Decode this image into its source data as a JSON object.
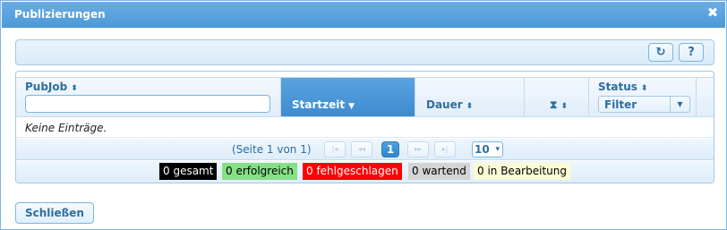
{
  "dialog": {
    "title": "Publizierungen",
    "close_symbol": "✖"
  },
  "toolbar": {
    "refresh_icon": "↻",
    "help_label": "?"
  },
  "grid": {
    "columns": [
      {
        "label": "PubJob",
        "sort_icon": "⬍"
      },
      {
        "label": "Startzeit",
        "sort_icon": "▼"
      },
      {
        "label": "Dauer",
        "sort_icon": "⬍"
      },
      {
        "label": "⧗",
        "sort_icon": "⬍"
      },
      {
        "label": "Status",
        "sort_icon": "⬍"
      }
    ],
    "pubjob_filter_value": "",
    "status_filter": {
      "selected": "Filter",
      "arrow": "▼"
    },
    "empty_text": "Keine Einträge."
  },
  "pager": {
    "info": "(Seite 1 von 1)",
    "first": "|◂",
    "prev": "◂◂",
    "current_page": "1",
    "next": "▸▸",
    "last": "▸|",
    "page_size": "10",
    "page_size_arrow": "▾"
  },
  "stats": [
    {
      "label": "0 gesamt",
      "bg": "#000000",
      "fg": "#ffffff"
    },
    {
      "label": "0 erfolgreich",
      "bg": "#86e086",
      "fg": "#000000"
    },
    {
      "label": "0 fehlgeschlagen",
      "bg": "#ff0000",
      "fg": "#ffffff"
    },
    {
      "label": "0 wartend",
      "bg": "#d4d4d4",
      "fg": "#000000"
    },
    {
      "label": "0 in Bearbeitung",
      "bg": "#fbfbd6",
      "fg": "#000000"
    }
  ],
  "footer": {
    "close_label": "Schließen"
  }
}
